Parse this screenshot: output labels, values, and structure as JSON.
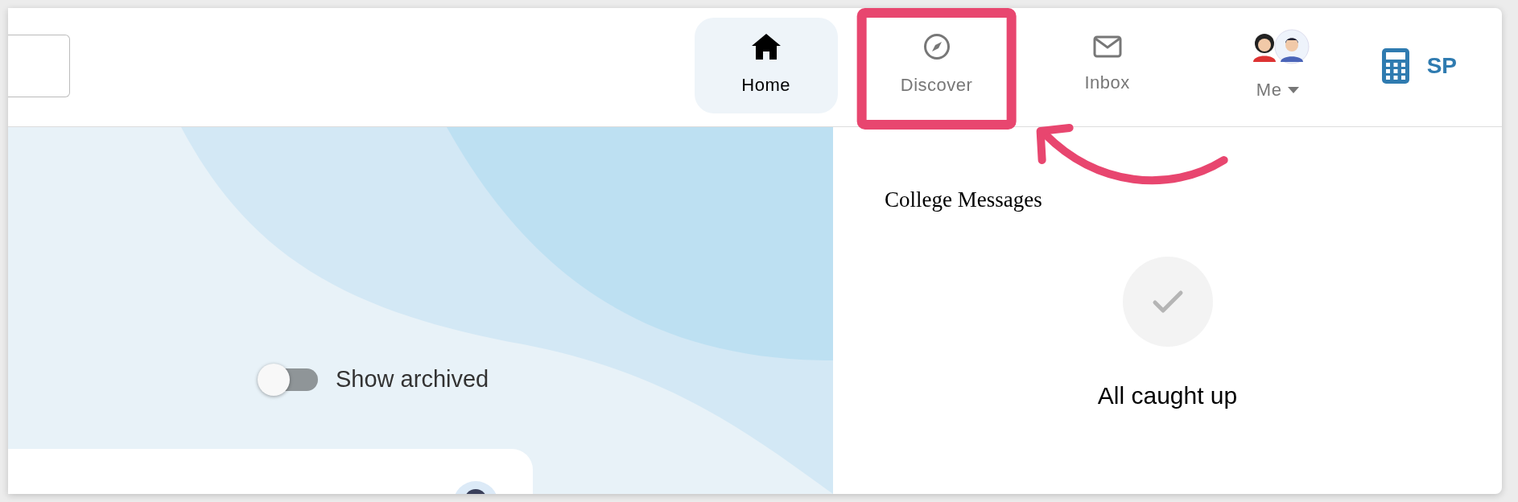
{
  "search": {
    "kind": "field"
  },
  "nav": [
    {
      "label": "Home",
      "selected": true,
      "annotated": false
    },
    {
      "label": "Discover",
      "selected": false,
      "annotated": true
    },
    {
      "label": "Inbox",
      "selected": false,
      "annotated": false
    },
    {
      "label": "Me",
      "selected": false,
      "annotated": false,
      "dropdown": true
    }
  ],
  "account": {
    "initials": "SP"
  },
  "archive_toggle": {
    "label": "Show archived",
    "on": false
  },
  "messages": {
    "title": "College Messages",
    "status": "All caught up"
  }
}
